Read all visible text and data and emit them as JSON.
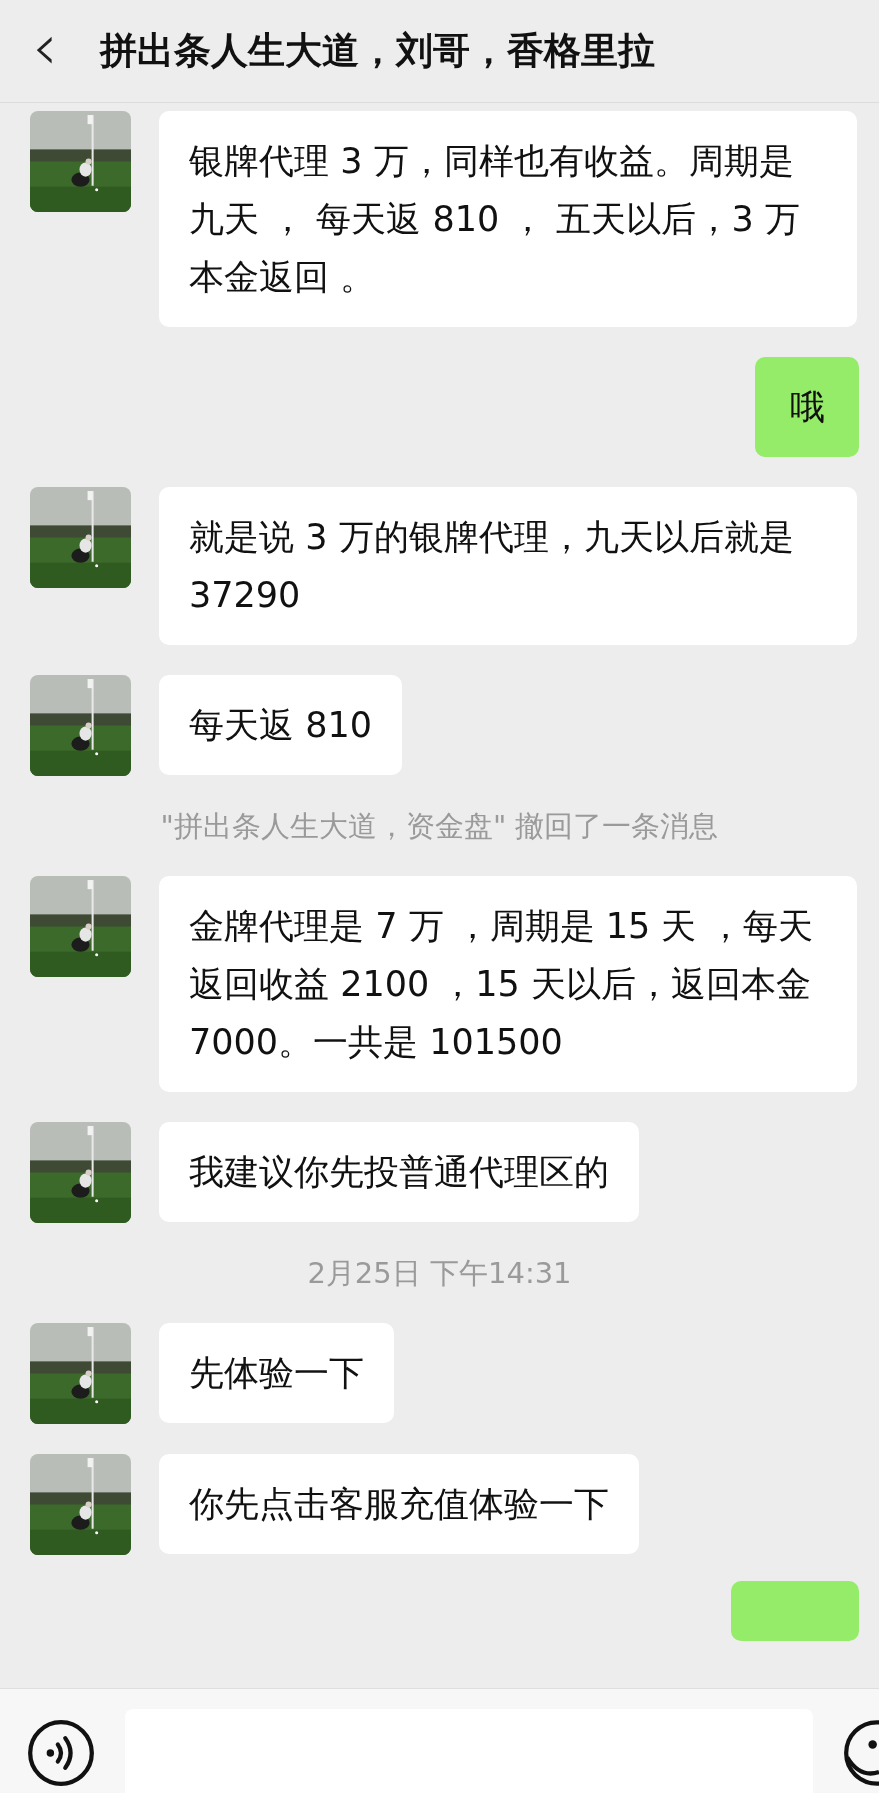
{
  "header": {
    "back_icon": "‹",
    "title": "拼出条人生大道，刘哥，香格里拉"
  },
  "messages": [
    {
      "kind": "received",
      "text": "银牌代理 3 万，同样也有收益。周期是九天 ， 每天返 810 ， 五天以后，3 万本金返回 。"
    },
    {
      "kind": "sent",
      "text": "哦"
    },
    {
      "kind": "received",
      "text": "就是说 3 万的银牌代理，九天以后就是 37290"
    },
    {
      "kind": "received",
      "text": "每天返 810"
    },
    {
      "kind": "notice",
      "text": "\"拼出条人生大道，资金盘\" 撤回了一条消息"
    },
    {
      "kind": "received",
      "text": "金牌代理是 7 万 ，周期是 15 天 ，每天返回收益 2100 ，15 天以后，返回本金 7000。一共是 101500"
    },
    {
      "kind": "received",
      "text": "我建议你先投普通代理区的"
    },
    {
      "kind": "time",
      "text": "2月25日 下午14:31"
    },
    {
      "kind": "received",
      "text": "先体验一下"
    },
    {
      "kind": "received",
      "text": "你先点击客服充值体验一下"
    },
    {
      "kind": "sent_cut"
    }
  ]
}
